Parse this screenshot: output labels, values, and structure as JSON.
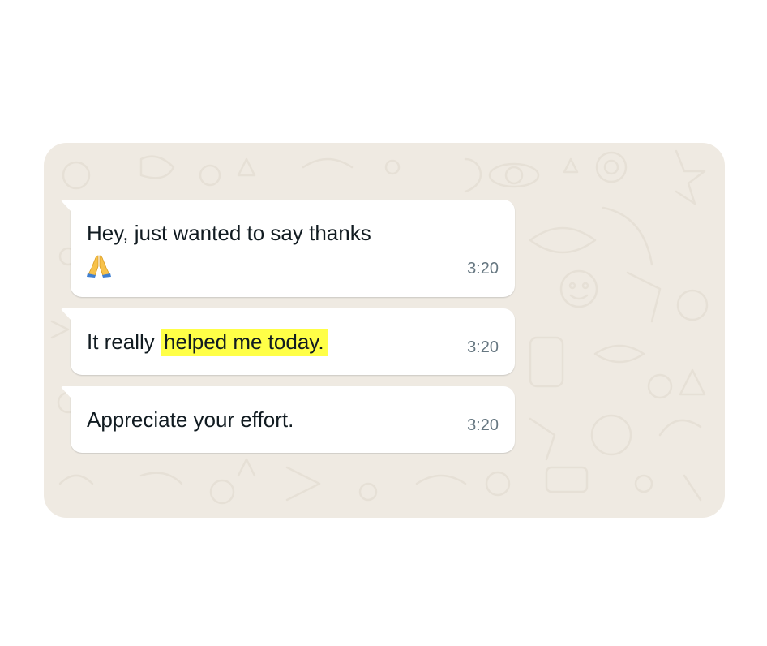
{
  "chat": {
    "background_color": "#efeae2",
    "bubble_color": "#ffffff",
    "highlight_color": "#ffff47",
    "messages": [
      {
        "text": "Hey, just wanted to say thanks",
        "emoji": "folded-hands",
        "time": "3:20"
      },
      {
        "text_before": "It really ",
        "text_highlight": "helped me today.",
        "time": "3:20"
      },
      {
        "text": "Appreciate your effort.",
        "time": "3:20"
      }
    ]
  }
}
